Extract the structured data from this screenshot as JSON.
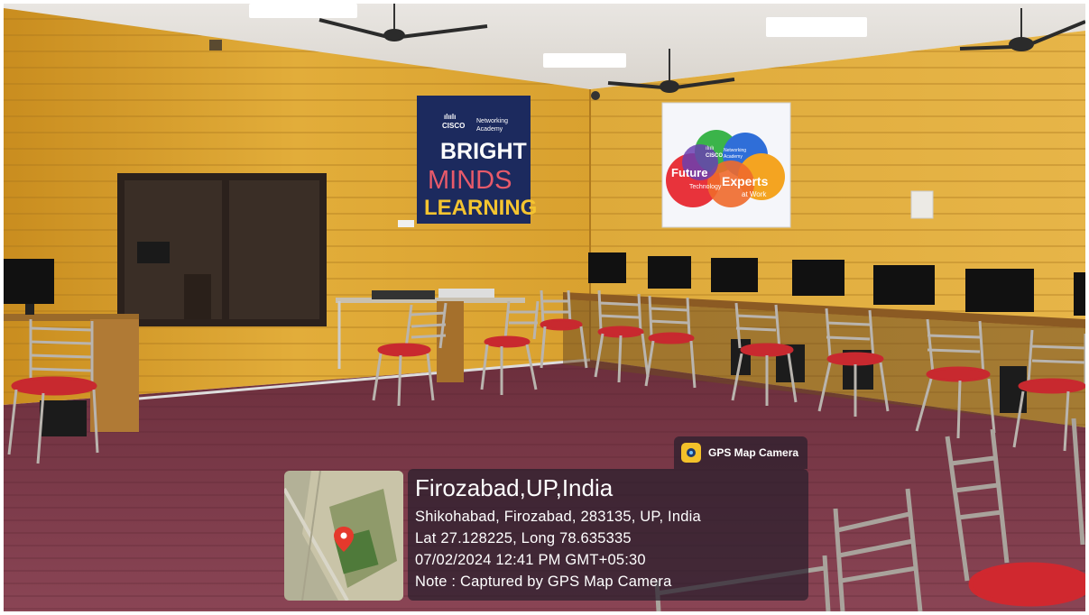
{
  "overlay": {
    "app_name": "GPS Map Camera",
    "location_title": "Firozabad,UP,India",
    "address": "Shikohabad, Firozabad, 283135, UP, India",
    "coordinates": "Lat 27.128225, Long 78.635335",
    "datetime": "07/02/2024 12:41 PM GMT+05:30",
    "note": "Note : Captured by GPS Map Camera"
  },
  "poster_left": {
    "brand": "CISCO",
    "academy_line1": "Networking",
    "academy_line2": "Academy",
    "word1": "BRIGHT",
    "word2": "MINDS",
    "word3": "LEARNING"
  },
  "poster_right": {
    "brand": "CISCO",
    "academy_line1": "Networking",
    "academy_line2": "Academy",
    "word_future": "Future",
    "word_technology": "Technology",
    "word_experts": "Experts",
    "word_atwork": "at Work"
  },
  "colors": {
    "wall": "#d9a22f",
    "floor": "#7a3a48",
    "poster_bg": "#1c2a5e",
    "overlay_bg": "#2b1f30"
  }
}
